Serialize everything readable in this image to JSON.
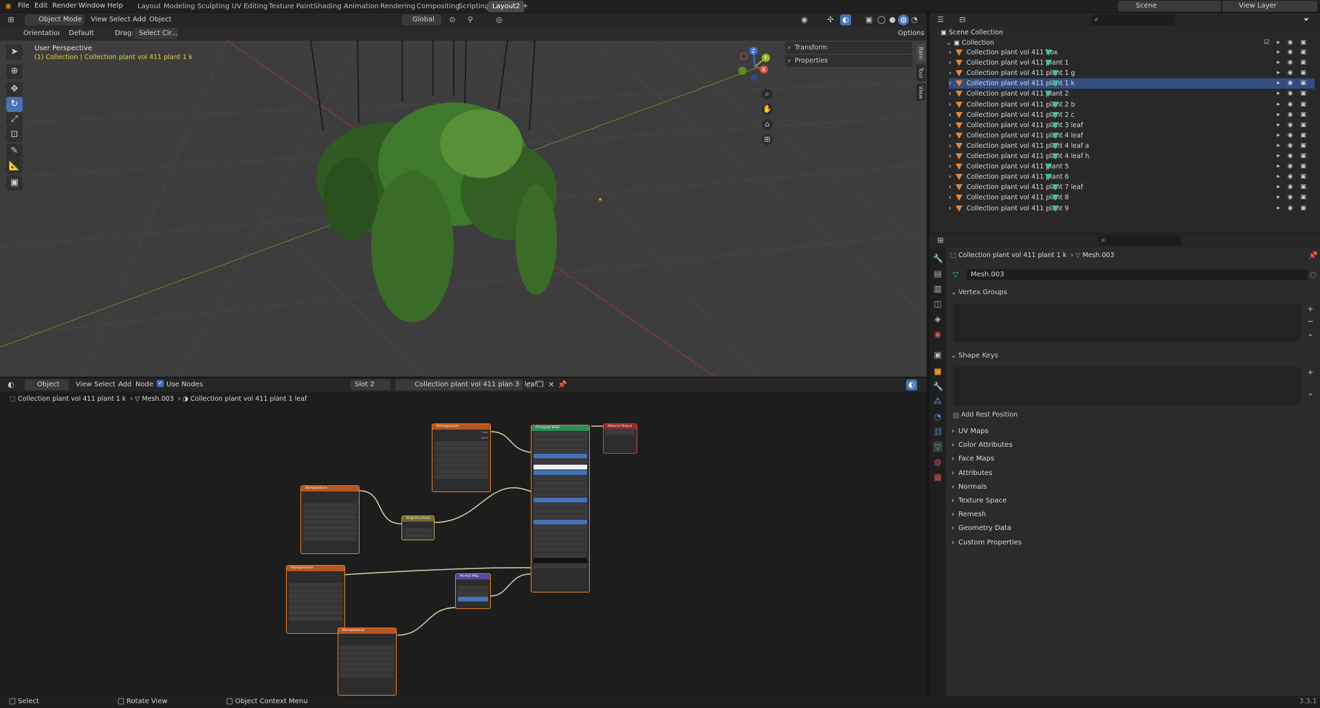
{
  "menus": [
    "File",
    "Edit",
    "Render",
    "Window",
    "Help"
  ],
  "workspaces": [
    "Layout",
    "Modeling",
    "Sculpting",
    "UV Editing",
    "Texture Paint",
    "Shading",
    "Animation",
    "Rendering",
    "Compositing",
    "Scripting",
    "Layout2"
  ],
  "active_workspace": "Layout2",
  "scene": "Scene",
  "view_layer": "View Layer",
  "viewport": {
    "mode": "Object Mode",
    "menus": [
      "View",
      "Select",
      "Add",
      "Object"
    ],
    "transform_space": "Global",
    "orientation_label": "Orientation:",
    "orientation_value": "Default",
    "drag_label": "Drag:",
    "drag_value": "Select Cir...",
    "options": "Options",
    "overlay_title": "User Perspective",
    "overlay_sub": "(1) Collection | Collection plant vol 411 plant 1 k",
    "npanel": [
      "Transform",
      "Properties"
    ],
    "side_tabs": [
      "Item",
      "Tool",
      "View"
    ],
    "gizmo": {
      "z": "Z",
      "y": "Y",
      "x": "X"
    }
  },
  "node_editor": {
    "mode": "Object",
    "menus": [
      "View",
      "Select",
      "Add",
      "Node"
    ],
    "use_nodes": "Use Nodes",
    "slot": "Slot 2",
    "material": "Collection plant vol 411 plant 1 leaf",
    "users": "3",
    "breadcrumb": [
      "Collection plant vol 411 plant 1 k",
      "Mesh.003",
      "Collection plant vol 411 plant 1 leaf"
    ]
  },
  "outliner": {
    "scene_collection": "Scene Collection",
    "collection": "Collection",
    "items": [
      "Collection plant vol 411 box",
      "Collection plant vol 411 plant 1",
      "Collection plant vol 411 plant 1 g",
      "Collection plant vol 411 plant 1 k",
      "Collection plant vol 411 plant 2",
      "Collection plant vol 411 plant 2 b",
      "Collection plant vol 411 plant 2 c",
      "Collection plant vol 411 plant 3 leaf",
      "Collection plant vol 411 plant 4 leaf",
      "Collection plant vol 411 plant 4 leaf a",
      "Collection plant vol 411 plant 4 leaf h",
      "Collection plant vol 411 plant 5",
      "Collection plant vol 411 plant 6",
      "Collection plant vol 411 plant 7 leaf",
      "Collection plant vol 411 plant 8",
      "Collection plant vol 411 plant 9"
    ]
  },
  "properties": {
    "object": "Collection plant vol 411 plant 1 k",
    "mesh": "Mesh.003",
    "mesh_field": "Mesh.003",
    "vertex_groups": "Vertex Groups",
    "shape_keys": "Shape Keys",
    "add_rest_position": "Add Rest Position",
    "panels": [
      "UV Maps",
      "Color Attributes",
      "Face Maps",
      "Attributes",
      "Normals",
      "Texture Space",
      "Remesh",
      "Geometry Data",
      "Custom Properties"
    ]
  },
  "nodes": {
    "img": "Bitmaptexture",
    "principled": "Principled BSDF",
    "output": "Material Output",
    "bright": "Bright/Contrast",
    "normal": "Normal Map"
  },
  "status": {
    "select": "Select",
    "rotate": "Rotate View",
    "context": "Object Context Menu",
    "version": "3.3.1"
  },
  "colors": {
    "accent": "#4772b3",
    "header": "#262626",
    "node_image": "#e8822a",
    "node_shader": "#2e8b57"
  }
}
